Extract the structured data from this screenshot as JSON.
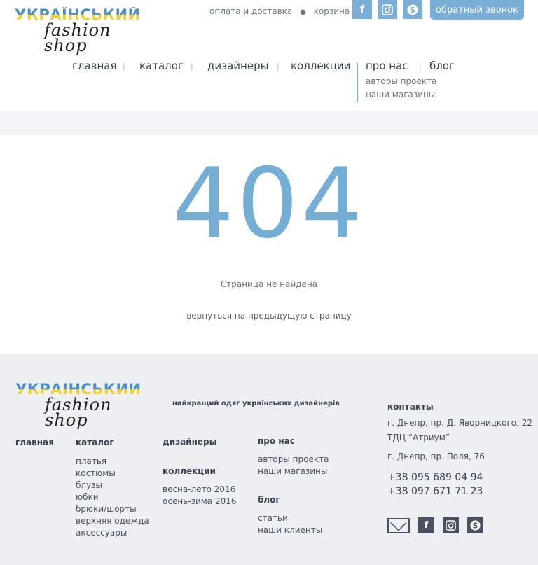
{
  "brand": {
    "logo_top": "УКРАЇНСЬКИЙ",
    "logo_bottom": "fashion shop"
  },
  "header": {
    "shipping_link": "оплата и доставка",
    "cart_link": "корзина (0)",
    "callback_button": "обратный звонок",
    "social": [
      "facebook-icon",
      "instagram-icon",
      "skype-icon"
    ]
  },
  "nav": {
    "items": [
      "главная",
      "каталог",
      "дизайнеры",
      "коллекции",
      "про нас",
      "блог"
    ],
    "submenu": [
      "авторы проекта",
      "наши магазины"
    ]
  },
  "main": {
    "code": "404",
    "message": "Страница не найдена",
    "back_link": "вернуться на предыдущую страницу"
  },
  "footer": {
    "tagline": "найкращий одяг українських дизайнерів",
    "col_home": "главная",
    "catalog": {
      "title": "каталог",
      "items": [
        "платья",
        "костюмы",
        "блузы",
        "юбки",
        "брюки/шорты",
        "верхняя одежда",
        "аксессуары"
      ]
    },
    "designers": "дизайнеры",
    "collections": {
      "title": "коллекции",
      "items": [
        "весна-лето 2016",
        "осень-зима 2016"
      ]
    },
    "about": {
      "title": "про нас",
      "items": [
        "авторы проекта",
        "наши магазины"
      ]
    },
    "blog": {
      "title": "блог",
      "items": [
        "статьи",
        "наши клиенты"
      ]
    },
    "contacts": {
      "title": "контакты",
      "address1": "г. Днепр, пр. Д. Яворницкого, 22",
      "address1b": "ТДЦ “Атриум”",
      "address2": "г. Днепр, пр. Поля, 76",
      "phone1": "+38 095 689 04 94",
      "phone2": "+38 097 671 71 23"
    }
  },
  "colors": {
    "accent": "#74aed4",
    "footer_bg": "#eeeff3",
    "logo_blue": "#4a8fcc",
    "logo_yellow": "#f1d02b"
  }
}
